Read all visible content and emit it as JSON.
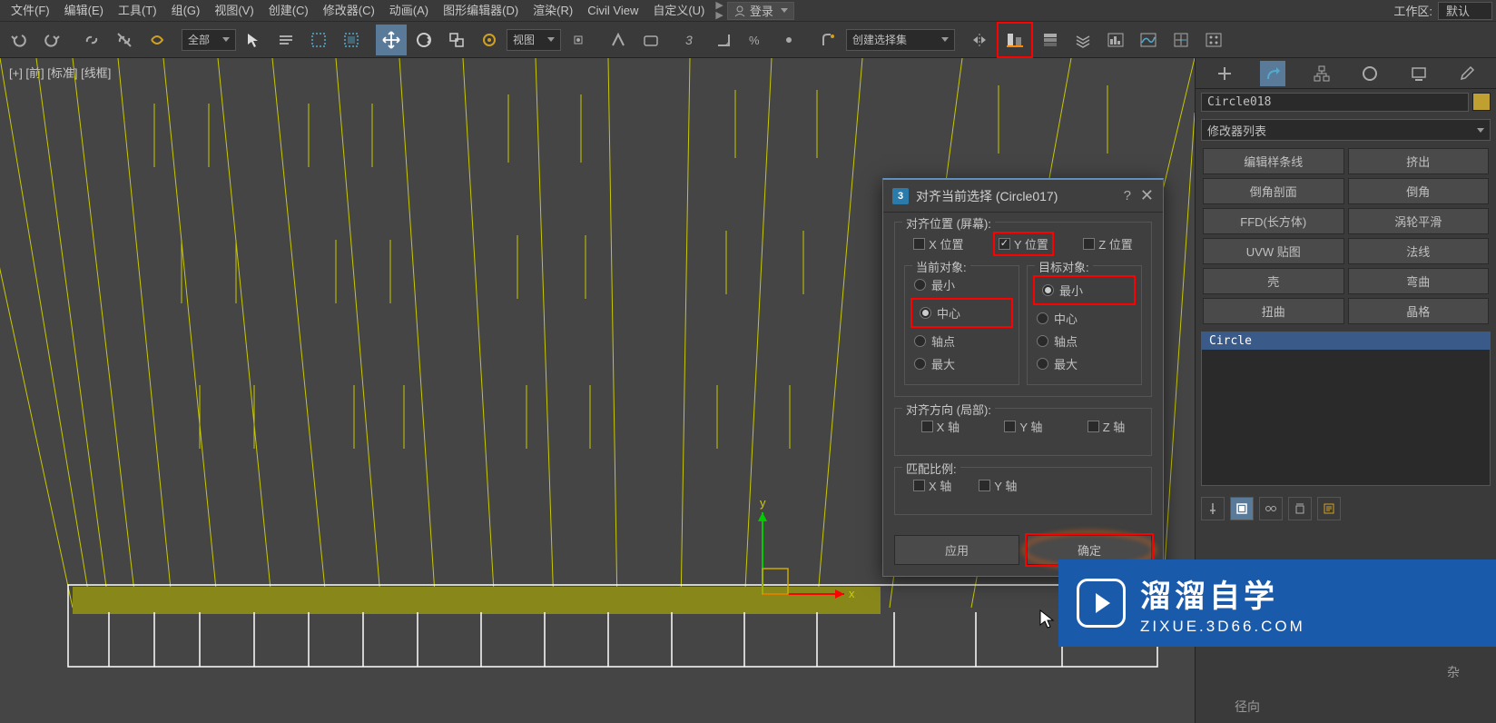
{
  "menu": {
    "file": "文件(F)",
    "edit": "编辑(E)",
    "tools": "工具(T)",
    "group": "组(G)",
    "view": "视图(V)",
    "create": "创建(C)",
    "modifiers": "修改器(C)",
    "animation": "动画(A)",
    "graph": "图形编辑器(D)",
    "render": "渲染(R)",
    "civil": "Civil View",
    "customize": "自定义(U)",
    "login": "登录",
    "workspace_label": "工作区:",
    "workspace_value": "默认"
  },
  "toolbar": {
    "filter": "全部",
    "coord": "视图",
    "named_set": "创建选择集"
  },
  "viewport": {
    "label": "[+] [前] [标准] [线框]"
  },
  "panel": {
    "object_name": "Circle018",
    "modifier_list": "修改器列表",
    "buttons": [
      "编辑样条线",
      "挤出",
      "倒角剖面",
      "倒角",
      "FFD(长方体)",
      "涡轮平滑",
      "UVW 贴图",
      "法线",
      "壳",
      "弯曲",
      "扭曲",
      "晶格"
    ],
    "stack_item": "Circle"
  },
  "dialog": {
    "title": "对齐当前选择 (Circle017)",
    "group_position": "对齐位置 (屏幕):",
    "x_pos": "X 位置",
    "y_pos": "Y 位置",
    "z_pos": "Z 位置",
    "current_obj": "当前对象:",
    "target_obj": "目标对象:",
    "min": "最小",
    "center": "中心",
    "pivot": "轴点",
    "max": "最大",
    "group_orient": "对齐方向 (局部):",
    "x_axis": "X 轴",
    "y_axis": "Y 轴",
    "z_axis": "Z 轴",
    "group_scale": "匹配比例:",
    "apply": "应用",
    "ok": "确定"
  },
  "watermark": {
    "big": "溜溜自学",
    "small": "ZIXUE.3D66.COM"
  },
  "bottom": {
    "text1": "杂",
    "text2": "径向"
  }
}
